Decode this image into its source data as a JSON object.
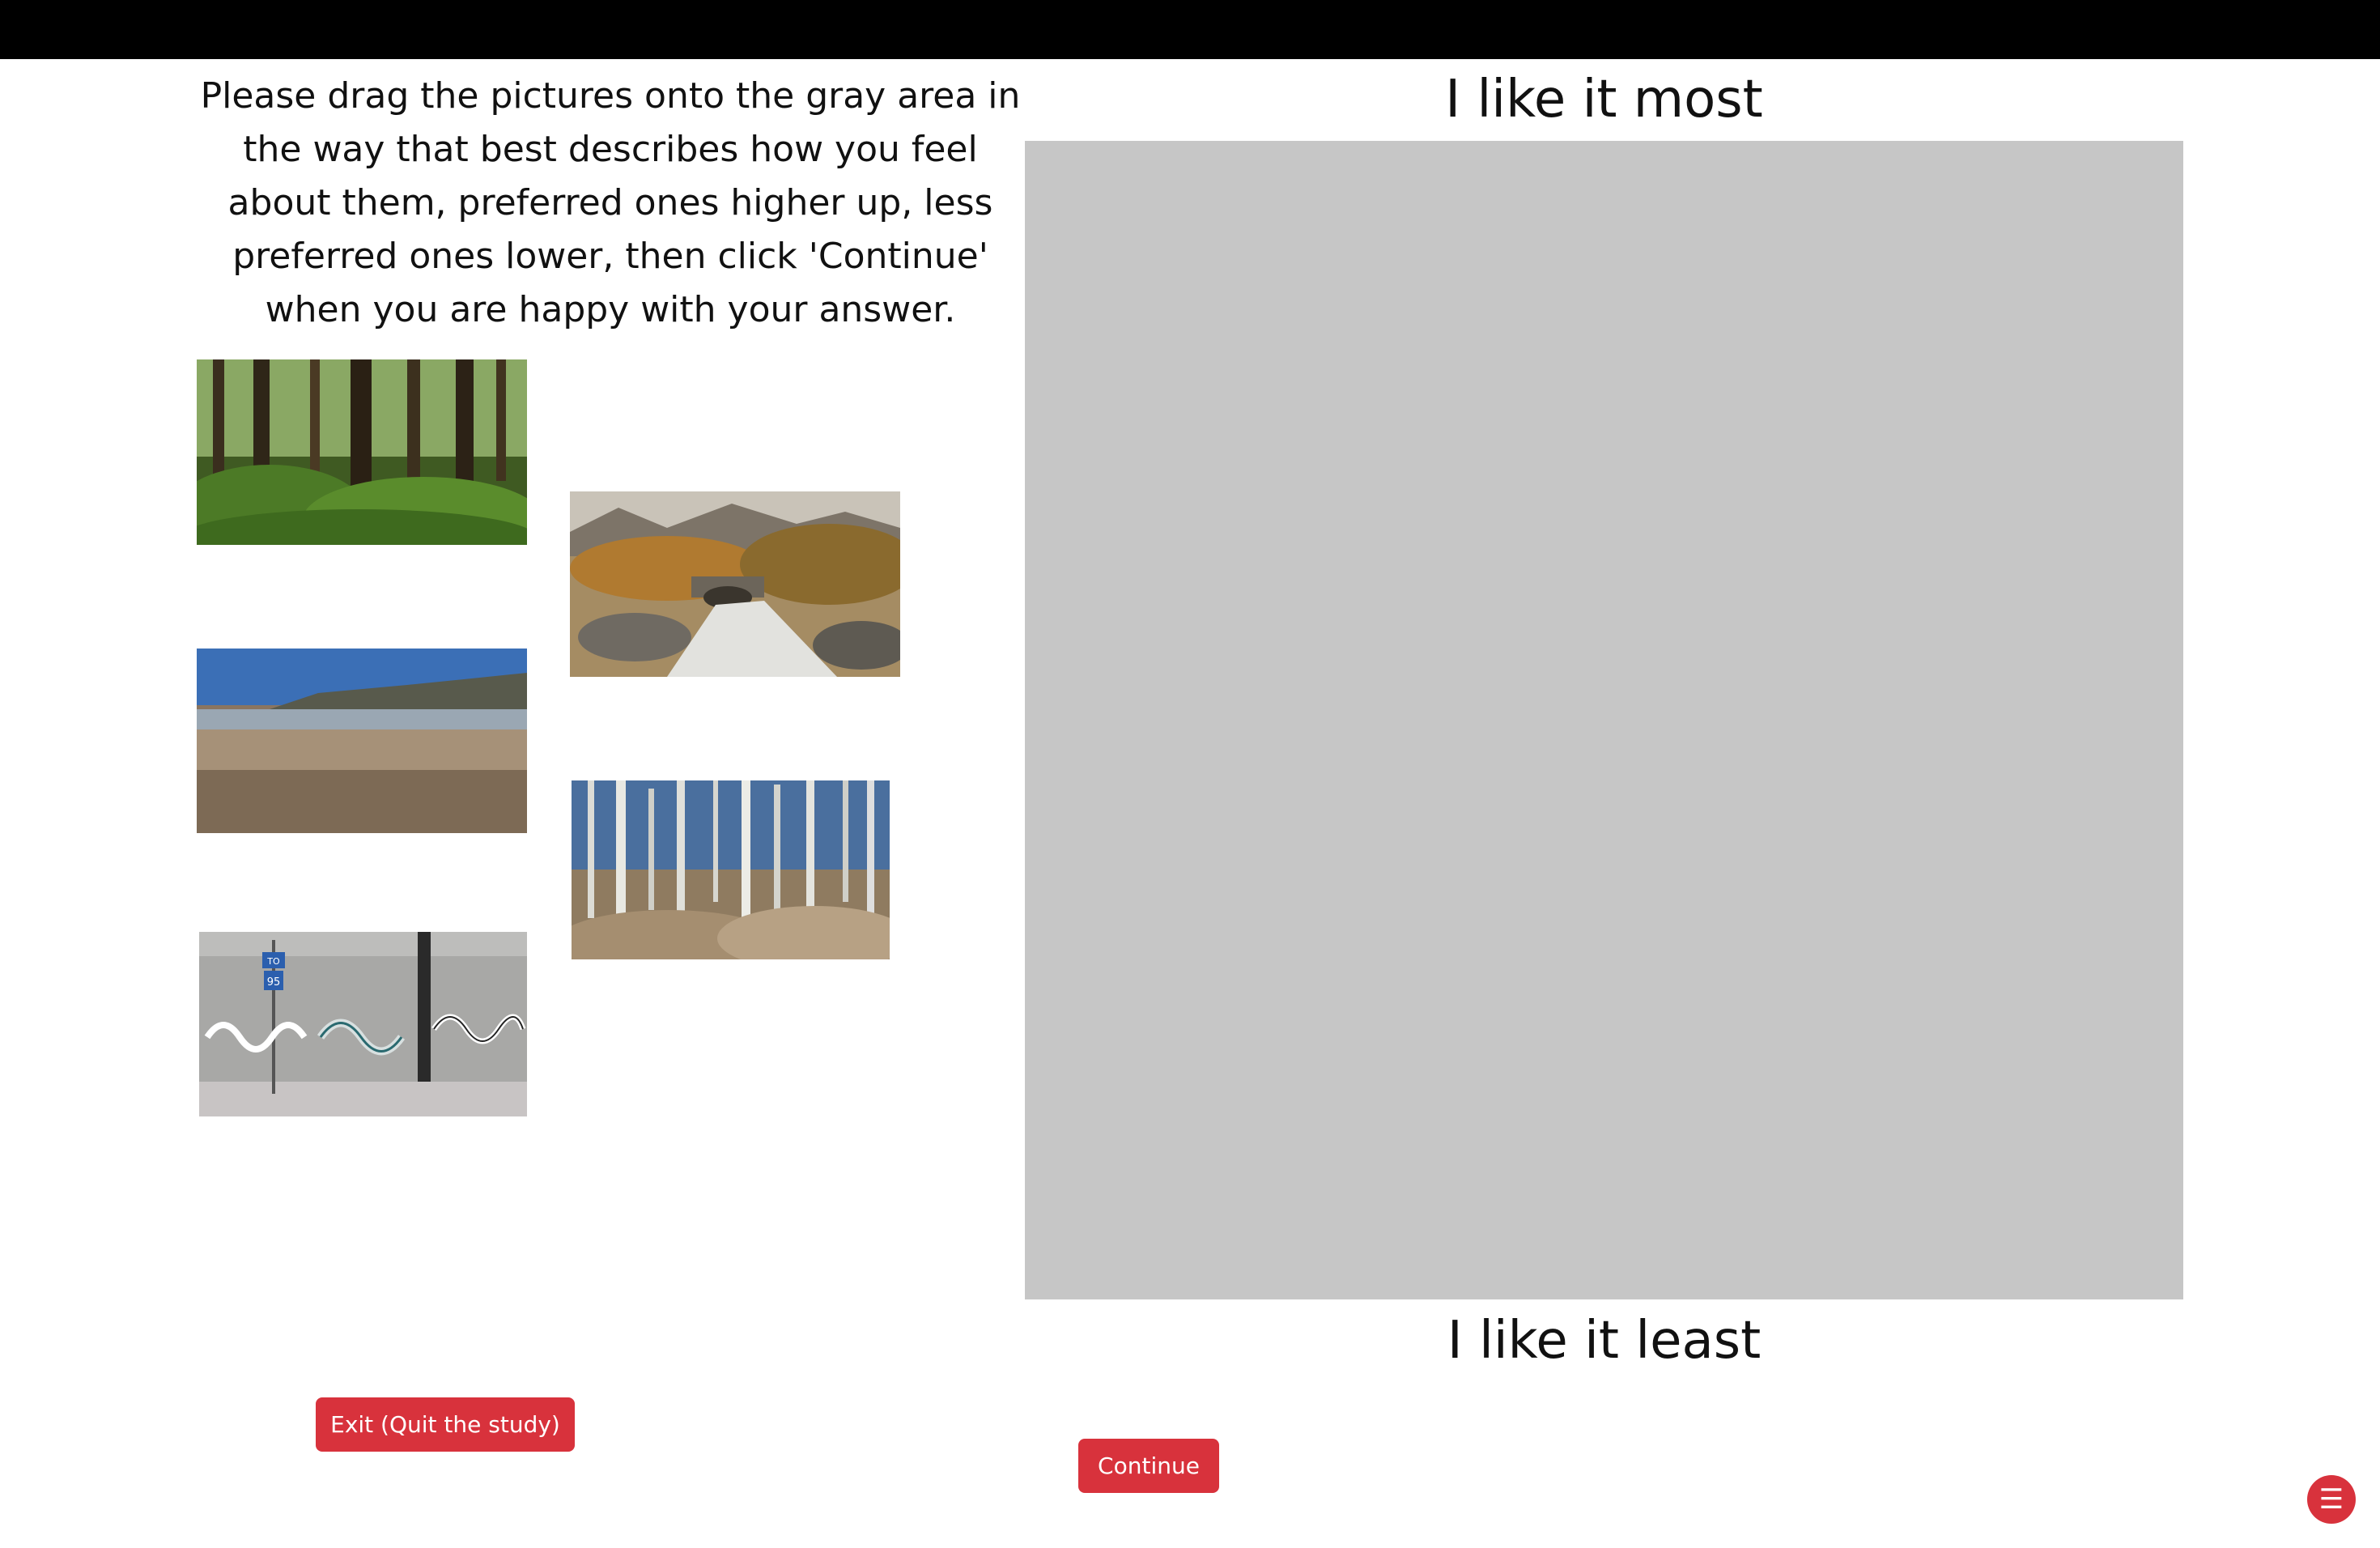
{
  "instructions": "Please drag the pictures onto the gray area in the way that best describes how you feel about them, preferred ones higher up, less preferred ones lower, then click 'Continue' when you are happy with your answer.",
  "ranking": {
    "top_label": "I like it most",
    "bottom_label": "I like it least"
  },
  "pictures": [
    {
      "name": "forest"
    },
    {
      "name": "river-bridge"
    },
    {
      "name": "beach-cliff"
    },
    {
      "name": "dead-trees"
    },
    {
      "name": "graffiti-wall"
    }
  ],
  "graffiti_sign": {
    "to": "TO",
    "route": "95"
  },
  "buttons": {
    "exit_label": "Exit (Quit the study)",
    "continue_label": "Continue"
  },
  "menu": {
    "icon": "☰"
  },
  "colors": {
    "topbar": "#000000",
    "drop_area": "#c6c6c6",
    "button": "#d8323c"
  }
}
